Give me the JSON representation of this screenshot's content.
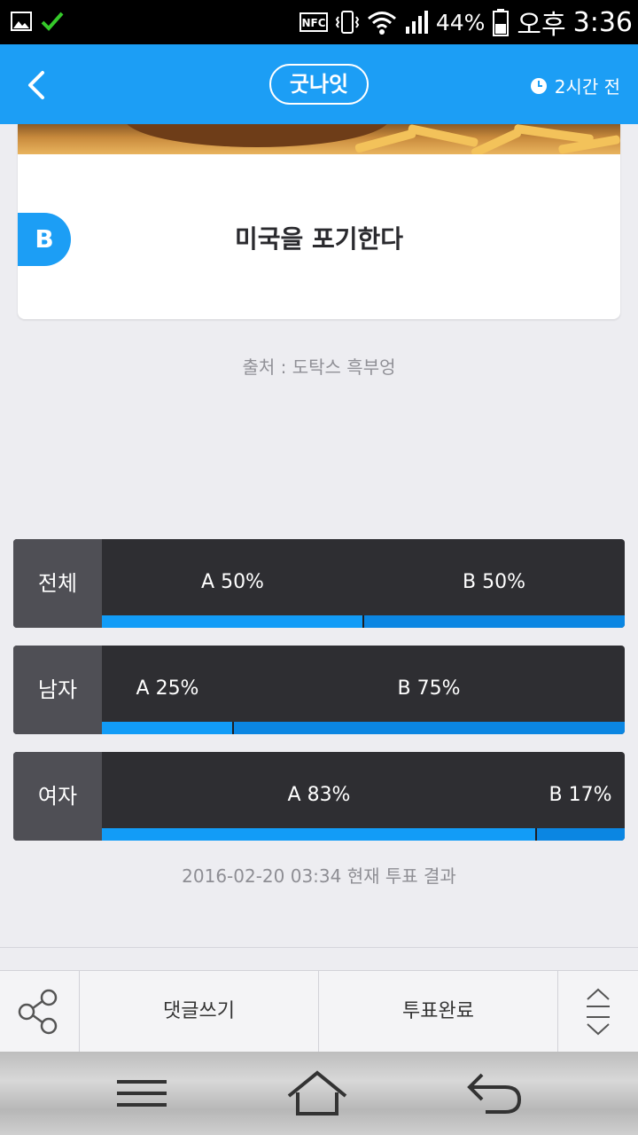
{
  "status_bar": {
    "battery": "44%",
    "ampm": "오후",
    "time": "3:36"
  },
  "header": {
    "brand": "굿나잇",
    "time_ago": "2시간 전"
  },
  "card": {
    "option_badge": "B",
    "option_text": "미국을 포기한다"
  },
  "source": "출처 : 도탁스 흑부엉",
  "results": [
    {
      "label": "전체",
      "a_label": "A 50%",
      "b_label": "B 50%",
      "a_fraction": 0.5
    },
    {
      "label": "남자",
      "a_label": "A 25%",
      "b_label": "B 75%",
      "a_fraction": 0.25
    },
    {
      "label": "여자",
      "a_label": "A 83%",
      "b_label": "B 17%",
      "a_fraction": 0.83
    }
  ],
  "result_note": "2016-02-20 03:34 현재 투표 결과",
  "toolbar": {
    "comment_label": "댓글쓰기",
    "vote_label": "투표완료"
  },
  "colors": {
    "accent": "#1c9ef5",
    "bar_a": "#129cf7",
    "bar_b": "#0b86e2",
    "row_bg": "#2e2e32",
    "label_bg": "#4f4f55"
  },
  "icons": [
    "image-icon",
    "check-icon",
    "nfc-icon",
    "vibrate-icon",
    "wifi-icon",
    "signal-icon",
    "battery-icon",
    "back-icon",
    "clock-icon",
    "share-icon",
    "scroll-toggle-icon",
    "menu-icon",
    "home-icon",
    "return-icon"
  ]
}
